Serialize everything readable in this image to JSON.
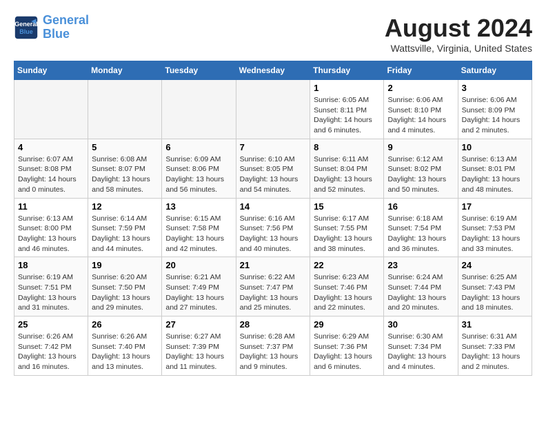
{
  "header": {
    "logo_line1": "General",
    "logo_line2": "Blue",
    "month": "August 2024",
    "location": "Wattsville, Virginia, United States"
  },
  "weekdays": [
    "Sunday",
    "Monday",
    "Tuesday",
    "Wednesday",
    "Thursday",
    "Friday",
    "Saturday"
  ],
  "weeks": [
    [
      {
        "day": "",
        "empty": true
      },
      {
        "day": "",
        "empty": true
      },
      {
        "day": "",
        "empty": true
      },
      {
        "day": "",
        "empty": true
      },
      {
        "day": "1",
        "sunrise": "6:05 AM",
        "sunset": "8:11 PM",
        "daylight": "14 hours and 6 minutes."
      },
      {
        "day": "2",
        "sunrise": "6:06 AM",
        "sunset": "8:10 PM",
        "daylight": "14 hours and 4 minutes."
      },
      {
        "day": "3",
        "sunrise": "6:06 AM",
        "sunset": "8:09 PM",
        "daylight": "14 hours and 2 minutes."
      }
    ],
    [
      {
        "day": "4",
        "sunrise": "6:07 AM",
        "sunset": "8:08 PM",
        "daylight": "14 hours and 0 minutes."
      },
      {
        "day": "5",
        "sunrise": "6:08 AM",
        "sunset": "8:07 PM",
        "daylight": "13 hours and 58 minutes."
      },
      {
        "day": "6",
        "sunrise": "6:09 AM",
        "sunset": "8:06 PM",
        "daylight": "13 hours and 56 minutes."
      },
      {
        "day": "7",
        "sunrise": "6:10 AM",
        "sunset": "8:05 PM",
        "daylight": "13 hours and 54 minutes."
      },
      {
        "day": "8",
        "sunrise": "6:11 AM",
        "sunset": "8:04 PM",
        "daylight": "13 hours and 52 minutes."
      },
      {
        "day": "9",
        "sunrise": "6:12 AM",
        "sunset": "8:02 PM",
        "daylight": "13 hours and 50 minutes."
      },
      {
        "day": "10",
        "sunrise": "6:13 AM",
        "sunset": "8:01 PM",
        "daylight": "13 hours and 48 minutes."
      }
    ],
    [
      {
        "day": "11",
        "sunrise": "6:13 AM",
        "sunset": "8:00 PM",
        "daylight": "13 hours and 46 minutes."
      },
      {
        "day": "12",
        "sunrise": "6:14 AM",
        "sunset": "7:59 PM",
        "daylight": "13 hours and 44 minutes."
      },
      {
        "day": "13",
        "sunrise": "6:15 AM",
        "sunset": "7:58 PM",
        "daylight": "13 hours and 42 minutes."
      },
      {
        "day": "14",
        "sunrise": "6:16 AM",
        "sunset": "7:56 PM",
        "daylight": "13 hours and 40 minutes."
      },
      {
        "day": "15",
        "sunrise": "6:17 AM",
        "sunset": "7:55 PM",
        "daylight": "13 hours and 38 minutes."
      },
      {
        "day": "16",
        "sunrise": "6:18 AM",
        "sunset": "7:54 PM",
        "daylight": "13 hours and 36 minutes."
      },
      {
        "day": "17",
        "sunrise": "6:19 AM",
        "sunset": "7:53 PM",
        "daylight": "13 hours and 33 minutes."
      }
    ],
    [
      {
        "day": "18",
        "sunrise": "6:19 AM",
        "sunset": "7:51 PM",
        "daylight": "13 hours and 31 minutes."
      },
      {
        "day": "19",
        "sunrise": "6:20 AM",
        "sunset": "7:50 PM",
        "daylight": "13 hours and 29 minutes."
      },
      {
        "day": "20",
        "sunrise": "6:21 AM",
        "sunset": "7:49 PM",
        "daylight": "13 hours and 27 minutes."
      },
      {
        "day": "21",
        "sunrise": "6:22 AM",
        "sunset": "7:47 PM",
        "daylight": "13 hours and 25 minutes."
      },
      {
        "day": "22",
        "sunrise": "6:23 AM",
        "sunset": "7:46 PM",
        "daylight": "13 hours and 22 minutes."
      },
      {
        "day": "23",
        "sunrise": "6:24 AM",
        "sunset": "7:44 PM",
        "daylight": "13 hours and 20 minutes."
      },
      {
        "day": "24",
        "sunrise": "6:25 AM",
        "sunset": "7:43 PM",
        "daylight": "13 hours and 18 minutes."
      }
    ],
    [
      {
        "day": "25",
        "sunrise": "6:26 AM",
        "sunset": "7:42 PM",
        "daylight": "13 hours and 16 minutes."
      },
      {
        "day": "26",
        "sunrise": "6:26 AM",
        "sunset": "7:40 PM",
        "daylight": "13 hours and 13 minutes."
      },
      {
        "day": "27",
        "sunrise": "6:27 AM",
        "sunset": "7:39 PM",
        "daylight": "13 hours and 11 minutes."
      },
      {
        "day": "28",
        "sunrise": "6:28 AM",
        "sunset": "7:37 PM",
        "daylight": "13 hours and 9 minutes."
      },
      {
        "day": "29",
        "sunrise": "6:29 AM",
        "sunset": "7:36 PM",
        "daylight": "13 hours and 6 minutes."
      },
      {
        "day": "30",
        "sunrise": "6:30 AM",
        "sunset": "7:34 PM",
        "daylight": "13 hours and 4 minutes."
      },
      {
        "day": "31",
        "sunrise": "6:31 AM",
        "sunset": "7:33 PM",
        "daylight": "13 hours and 2 minutes."
      }
    ]
  ]
}
